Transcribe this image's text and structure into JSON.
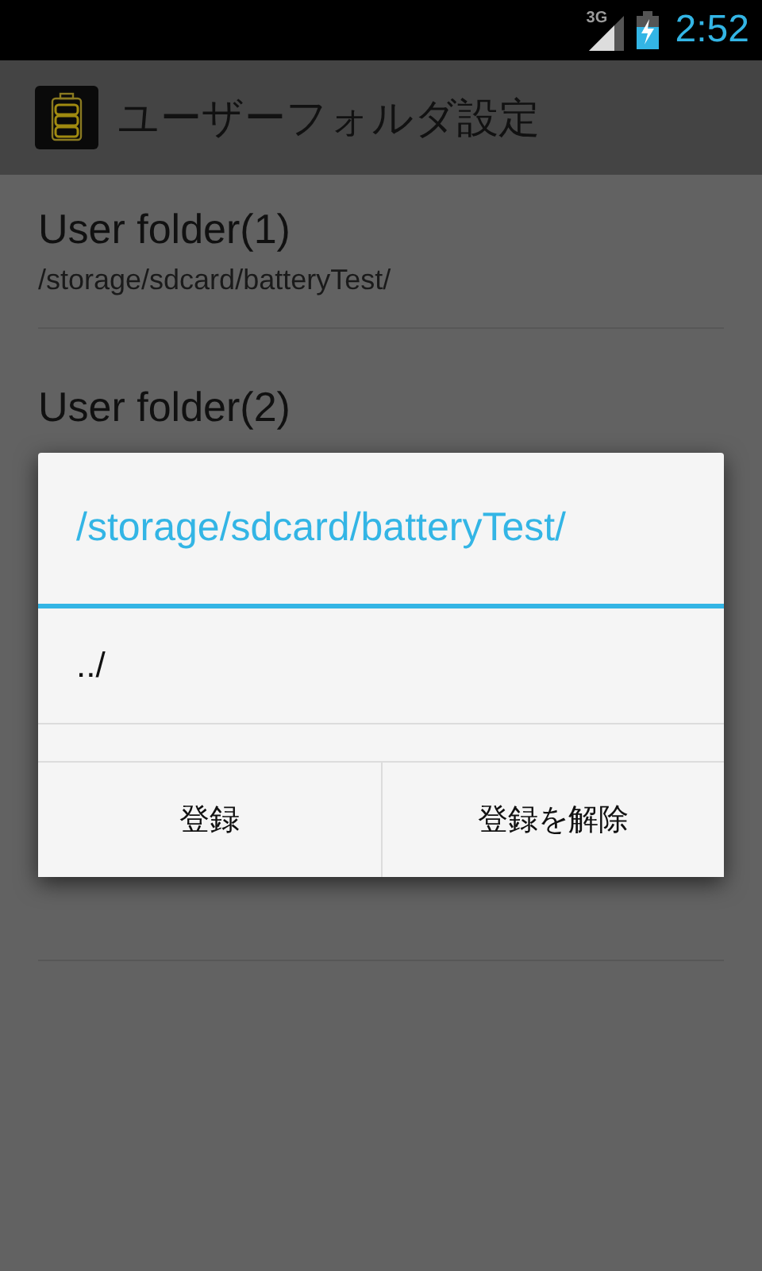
{
  "status_bar": {
    "network": "3G",
    "time": "2:52"
  },
  "app_bar": {
    "title": "ユーザーフォルダ設定"
  },
  "folders": [
    {
      "title": "User folder(1)",
      "path": "/storage/sdcard/batteryTest/"
    },
    {
      "title": "User folder(2)"
    }
  ],
  "dialog": {
    "title": "/storage/sdcard/batteryTest/",
    "items": [
      "../"
    ],
    "buttons": [
      "登録",
      "登録を解除"
    ]
  }
}
